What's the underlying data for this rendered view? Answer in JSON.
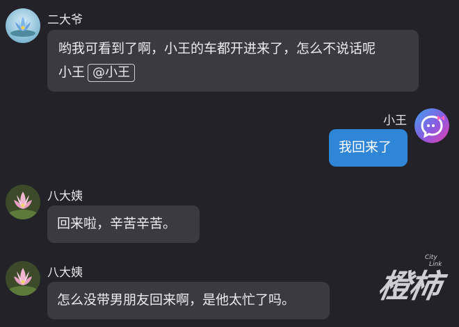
{
  "messages": [
    {
      "sender": "二大爷",
      "avatar_caption": "...",
      "text": "哟我可看到了啊，小王的车都开进来了，怎么不说话呢",
      "text_line2": "小王",
      "mention": "@小王"
    },
    {
      "sender": "小王",
      "text": "我回来了"
    },
    {
      "sender": "八大姨",
      "text": "回来啦，辛苦辛苦。"
    },
    {
      "sender": "八大姨",
      "text": "怎么没带男朋友回来啊，是他太忙了吗。"
    }
  ],
  "watermark": {
    "text": "橙柿",
    "sub1": "City",
    "sub2": "Link"
  },
  "colors": {
    "background": "#222228",
    "bubble_other": "#3a3a40",
    "bubble_self": "#2f86d6"
  }
}
